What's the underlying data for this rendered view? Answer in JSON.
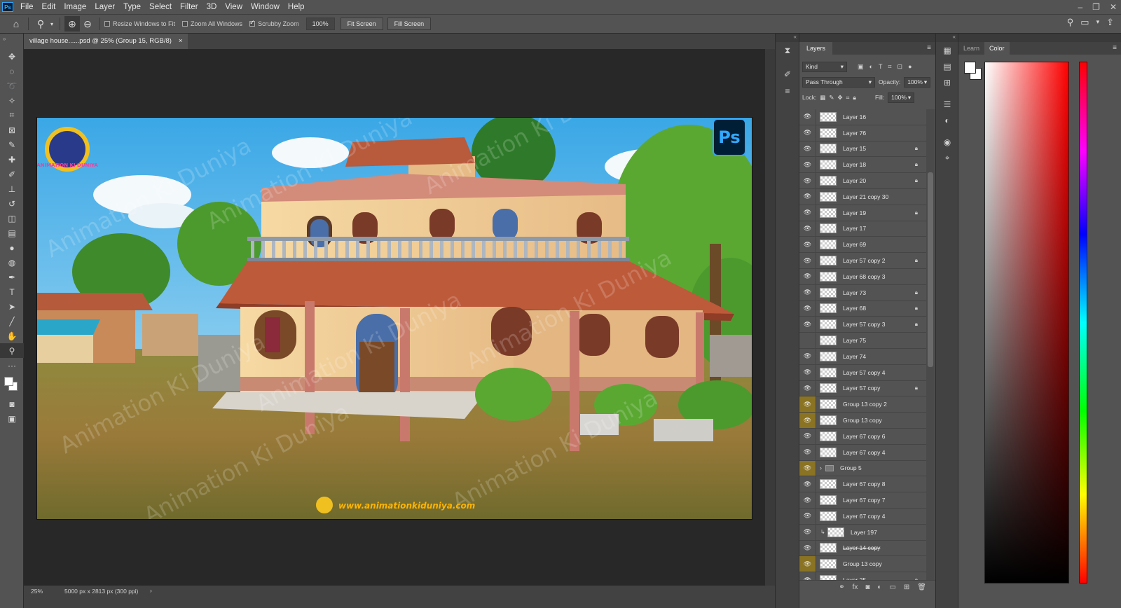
{
  "app": {
    "logo": "Ps",
    "menus": [
      "File",
      "Edit",
      "Image",
      "Layer",
      "Type",
      "Select",
      "Filter",
      "3D",
      "View",
      "Window",
      "Help"
    ]
  },
  "options": {
    "resize_windows": "Resize Windows to Fit",
    "zoom_all": "Zoom All Windows",
    "scrubby": "Scrubby Zoom",
    "zoom_value": "100%",
    "fit_screen": "Fit Screen",
    "fill_screen": "Fill Screen"
  },
  "document": {
    "tab_title": "village house......psd @ 25% (Group 15, RGB/8)",
    "close": "×"
  },
  "artwork": {
    "watermark": "Animation Ki Duniya",
    "website": "www.animationkiduniya.com",
    "logo_text": "ANIMATION KI DUNIYA",
    "ps_badge": "Ps"
  },
  "status": {
    "zoom": "25%",
    "doc_size": "5000 px x 2813 px (300 ppi)",
    "arrow": "›"
  },
  "layers_panel": {
    "title": "Layers",
    "kind_label": "Kind",
    "blend_mode": "Pass Through",
    "opacity_label": "Opacity:",
    "opacity_value": "100%",
    "lock_label": "Lock:",
    "fill_label": "Fill:",
    "fill_value": "100%",
    "layers": [
      {
        "name": "Layer 16",
        "eye": "visible",
        "lock": false,
        "type": "layer"
      },
      {
        "name": "Layer 76",
        "eye": "visible",
        "lock": false,
        "type": "layer"
      },
      {
        "name": "Layer 15",
        "eye": "visible",
        "lock": true,
        "type": "layer"
      },
      {
        "name": "Layer 18",
        "eye": "visible",
        "lock": true,
        "type": "layer"
      },
      {
        "name": "Layer 20",
        "eye": "visible",
        "lock": true,
        "type": "layer"
      },
      {
        "name": "Layer 21 copy 30",
        "eye": "visible",
        "lock": false,
        "type": "layer"
      },
      {
        "name": "Layer 19",
        "eye": "visible",
        "lock": true,
        "type": "layer"
      },
      {
        "name": "Layer 17",
        "eye": "visible",
        "lock": false,
        "type": "layer"
      },
      {
        "name": "Layer 69",
        "eye": "visible",
        "lock": false,
        "type": "layer"
      },
      {
        "name": "Layer 57 copy 2",
        "eye": "visible",
        "lock": true,
        "type": "layer"
      },
      {
        "name": "Layer 68 copy 3",
        "eye": "visible",
        "lock": false,
        "type": "layer"
      },
      {
        "name": "Layer 73",
        "eye": "visible",
        "lock": true,
        "type": "layer"
      },
      {
        "name": "Layer 68",
        "eye": "visible",
        "lock": true,
        "type": "layer"
      },
      {
        "name": "Layer 57 copy 3",
        "eye": "visible",
        "lock": true,
        "type": "layer"
      },
      {
        "name": "Layer 75",
        "eye": "hidden",
        "lock": false,
        "type": "layer"
      },
      {
        "name": "Layer 74",
        "eye": "visible",
        "lock": false,
        "type": "layer"
      },
      {
        "name": "Layer 57 copy 4",
        "eye": "visible",
        "lock": false,
        "type": "layer"
      },
      {
        "name": "Layer 57 copy",
        "eye": "visible",
        "lock": true,
        "type": "layer"
      },
      {
        "name": "Group 13 copy 2",
        "eye": "visible",
        "lock": false,
        "type": "highlight"
      },
      {
        "name": "Group 13 copy",
        "eye": "visible",
        "lock": false,
        "type": "highlight"
      },
      {
        "name": "Layer 67 copy 6",
        "eye": "visible",
        "lock": false,
        "type": "layer"
      },
      {
        "name": "Layer 67 copy 4",
        "eye": "visible",
        "lock": false,
        "type": "layer"
      },
      {
        "name": "Group 5",
        "eye": "visible",
        "lock": false,
        "type": "group"
      },
      {
        "name": "Layer 67 copy 8",
        "eye": "visible",
        "lock": false,
        "type": "layer"
      },
      {
        "name": "Layer 67 copy 7",
        "eye": "visible",
        "lock": false,
        "type": "layer"
      },
      {
        "name": "Layer 67 copy 4",
        "eye": "visible",
        "lock": false,
        "type": "layer"
      },
      {
        "name": "Layer 197",
        "eye": "visible",
        "lock": false,
        "type": "clip"
      },
      {
        "name": "Layer 14 copy",
        "eye": "visible",
        "lock": false,
        "type": "strike"
      },
      {
        "name": "Group 13 copy",
        "eye": "visible",
        "lock": false,
        "type": "highlight"
      },
      {
        "name": "Layer 25",
        "eye": "visible",
        "lock": true,
        "type": "layer"
      }
    ]
  },
  "color_panel": {
    "tabs": [
      "Learn",
      "Color"
    ],
    "active_tab": "Color"
  }
}
